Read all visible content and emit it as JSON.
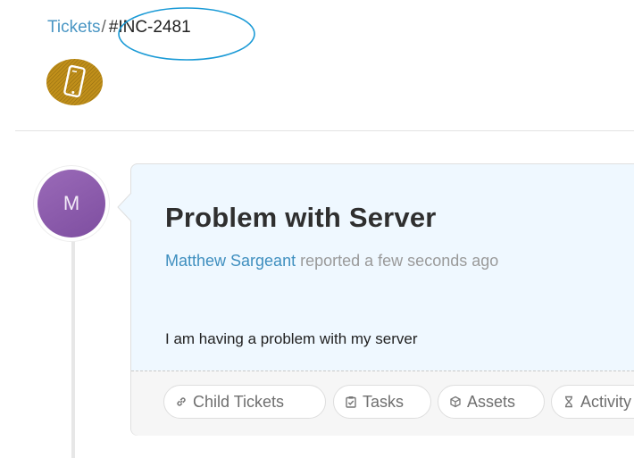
{
  "breadcrumb": {
    "parent_label": "Tickets",
    "separator": "/",
    "current_label": "#INC-2481"
  },
  "category_icon": {
    "icon": "smartphone-icon",
    "color": "#c08f1a"
  },
  "ticket": {
    "avatar_initial": "M",
    "title": "Problem with Server",
    "reporter": "Matthew Sargeant",
    "reported_text": "reported a few seconds ago",
    "body": "I am having a problem with my server",
    "tabs": [
      {
        "label": "Child Tickets",
        "icon": "link-icon"
      },
      {
        "label": "Tasks",
        "icon": "clipboard-check-icon"
      },
      {
        "label": "Assets",
        "icon": "cube-icon"
      },
      {
        "label": "Activity",
        "icon": "hourglass-icon"
      }
    ]
  },
  "colors": {
    "link": "#4a96c4",
    "avatar": "#8b5aaa",
    "card_background": "#eff8ff",
    "highlight": "#1a9ad6"
  }
}
